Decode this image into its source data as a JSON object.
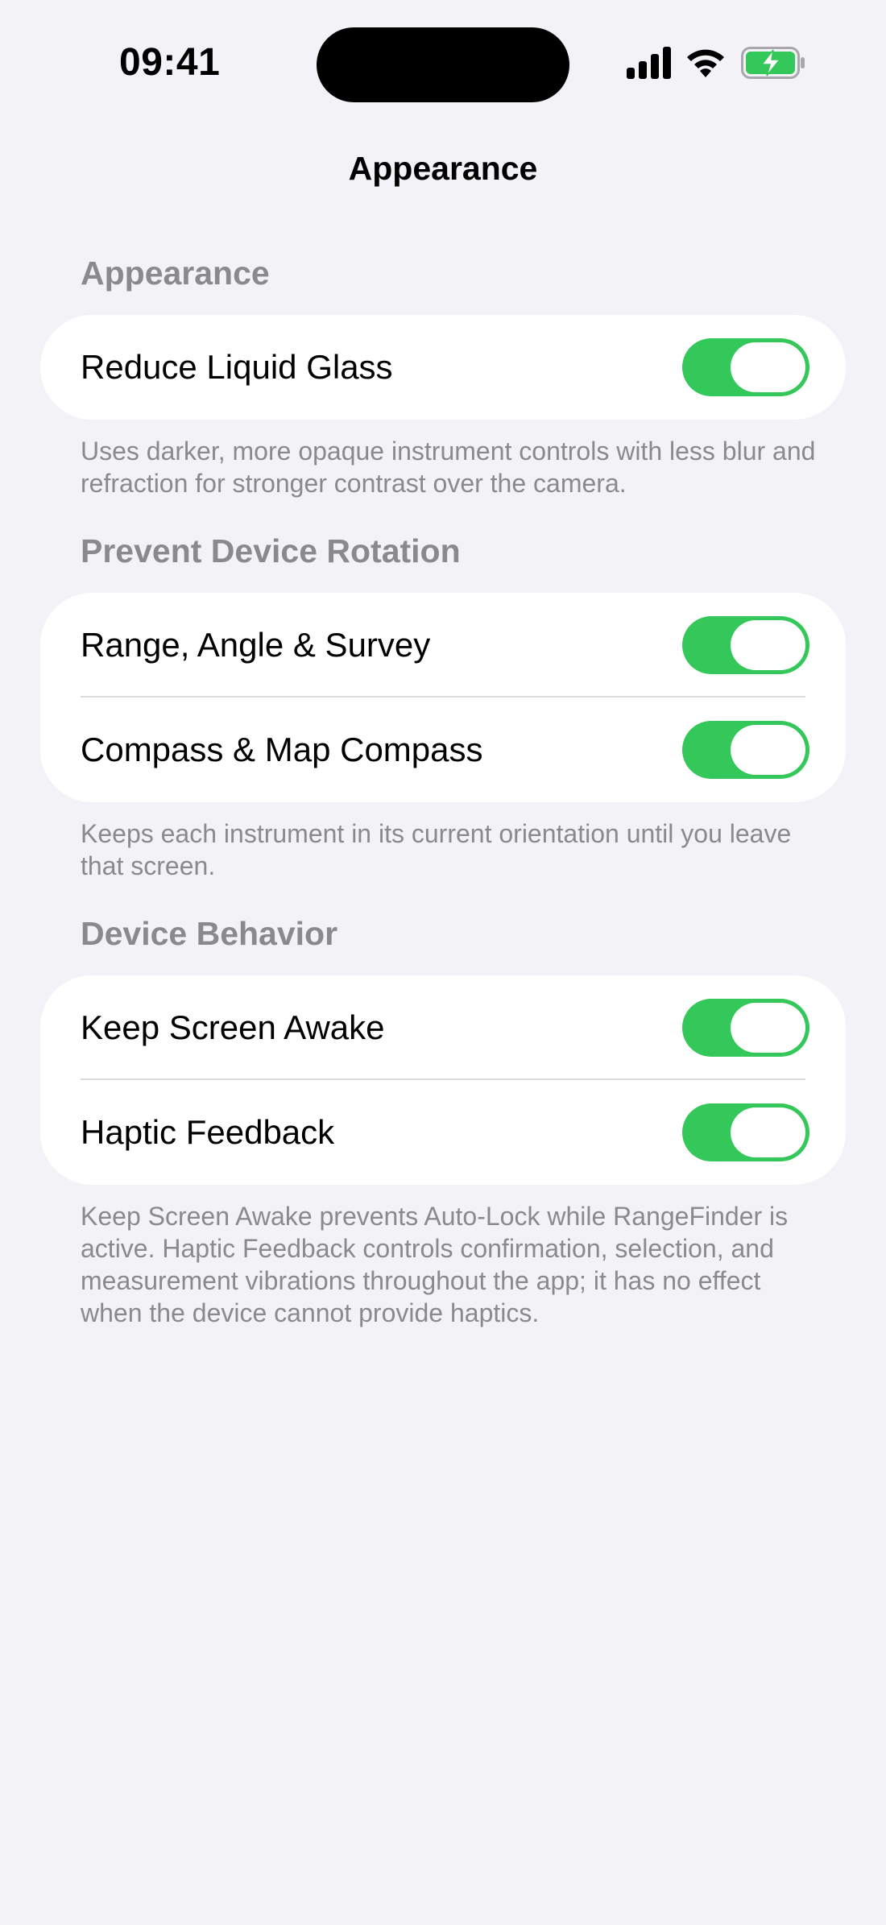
{
  "status_bar": {
    "time": "09:41",
    "icons": [
      "cellular-signal-icon",
      "wifi-icon",
      "battery-charging-icon"
    ],
    "battery_color": "#34C759"
  },
  "nav": {
    "title": "Appearance"
  },
  "sections": [
    {
      "header": "Appearance",
      "rows": [
        {
          "label": "Reduce Liquid Glass",
          "on": true
        }
      ],
      "footer": "Uses darker, more opaque instrument controls with less blur and refraction for stronger contrast over the camera."
    },
    {
      "header": "Prevent Device Rotation",
      "rows": [
        {
          "label": "Range, Angle & Survey",
          "on": true
        },
        {
          "label": "Compass & Map Compass",
          "on": true
        }
      ],
      "footer": "Keeps each instrument in its current orientation until you leave that screen."
    },
    {
      "header": "Device Behavior",
      "rows": [
        {
          "label": "Keep Screen Awake",
          "on": true
        },
        {
          "label": "Haptic Feedback",
          "on": true
        }
      ],
      "footer": "Keep Screen Awake prevents Auto-Lock while RangeFinder is active. Haptic Feedback controls confirmation, selection, and measurement vibrations throughout the app; it has no effect when the device cannot provide haptics."
    }
  ],
  "colors": {
    "background": "#F2F2F7",
    "card": "#FFFFFF",
    "toggle_on": "#34C759",
    "secondary_text": "#8A8A8E"
  }
}
